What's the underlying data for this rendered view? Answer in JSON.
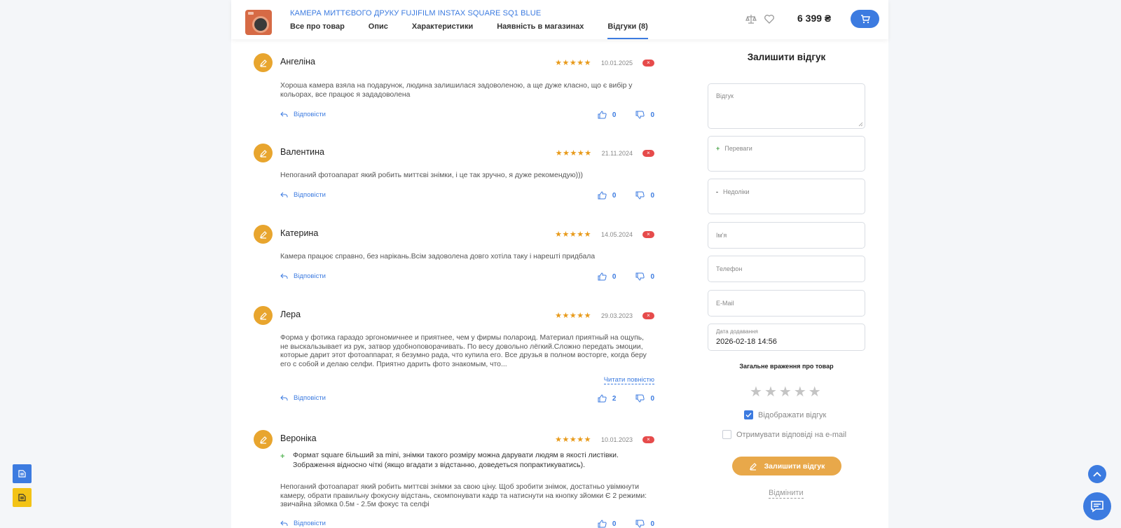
{
  "header": {
    "product_title": "КАМЕРА МИТТЄВОГО ДРУКУ FUJIFILM INSTAX SQUARE SQ1 BLUE",
    "tabs": [
      {
        "label": "Все про товар"
      },
      {
        "label": "Опис"
      },
      {
        "label": "Характеристики"
      },
      {
        "label": "Наявність в магазинах"
      },
      {
        "label": "Відгуки (8)"
      }
    ],
    "price": "6 399 ₴",
    "accent_color": "#3c7be0"
  },
  "reviews": [
    {
      "name": "Ангеліна",
      "stars": "★★★★★",
      "date": "10.01.2025",
      "text": "Хороша камера взяла на подарунок, людина залишилася задоволеною, а ще дуже класно, що є вибір у кольорах, все працює я зададоволена",
      "reply_label": "Відповісти",
      "likes": "0",
      "dislikes": "0"
    },
    {
      "name": "Валентина",
      "stars": "★★★★★",
      "date": "21.11.2024",
      "text": "Непоганий фотоапарат який робить миттєві знімки, і це так зручно, я дуже рекомендую)))",
      "reply_label": "Відповісти",
      "likes": "0",
      "dislikes": "0"
    },
    {
      "name": "Катерина",
      "stars": "★★★★★",
      "date": "14.05.2024",
      "text": "Камера працює справно, без нарікань.Всім задоволена довго хотіла таку і нарешті придбала",
      "reply_label": "Відповісти",
      "likes": "0",
      "dislikes": "0"
    },
    {
      "name": "Лера",
      "stars": "★★★★★",
      "date": "29.03.2023",
      "text": "Форма у фотика гараздо эргономичнее и приятнее, чем у фирмы полароид. Материал приятный на ощупь, не выскальзывает из рук, затвор удобноповорачивать. По весу довольно лёгкий.Сложно передать эмоции, которые дарит этот фотоаппарат, я безумно рада, что купила его. Все друзья в полном восторге, когда беру его с собой и делаю селфи. Приятно дарить фото знакомым, что...",
      "read_more": "Читати повністю",
      "reply_label": "Відповісти",
      "likes": "2",
      "dislikes": "0"
    },
    {
      "name": "Вероніка",
      "stars": "★★★★★",
      "date": "10.01.2023",
      "pros": "Формат square більший за mini, знімки такого розміру можна дарувати людям в якості листівки. Зображення відносно чіткі (якщо вгадати з відстанню, доведеться попрактикуватись).",
      "text": "Непоганий фотоапарат який робить миттєві знімки за свою ціну. Щоб зробити знімок, достатньо увімкнути камеру, обрати правильну фокусну відстань, скомпонувати кадр та натиснути на кнопку зйомки Є 2 режими: звичайна зйомка 0.5м - 2.5м фокус та селфі",
      "reply_label": "Відповісти",
      "likes": "0",
      "dislikes": "0"
    }
  ],
  "report_badge": "×",
  "form": {
    "title": "Залишити відгук",
    "review_placeholder": "Відгук",
    "pros_mark": "+",
    "pros_placeholder": "Переваги",
    "cons_mark": "-",
    "cons_placeholder": "Недоліки",
    "name_placeholder": "Ім'я",
    "phone_placeholder": "Телефон",
    "email_placeholder": "E-Mail",
    "date_label": "Дата додавання",
    "date_value": "2026-02-18 14:56",
    "impression_label": "Загальне враження про товар",
    "rating_value": 0,
    "rating_stars": "★★★★★",
    "show_review_label": "Відображати відгук",
    "show_review_checked": true,
    "email_replies_label": "Отримувати відповіді на e-mail",
    "email_replies_checked": false,
    "submit_label": "Залишити відгук",
    "cancel_label": "Відмінити"
  }
}
